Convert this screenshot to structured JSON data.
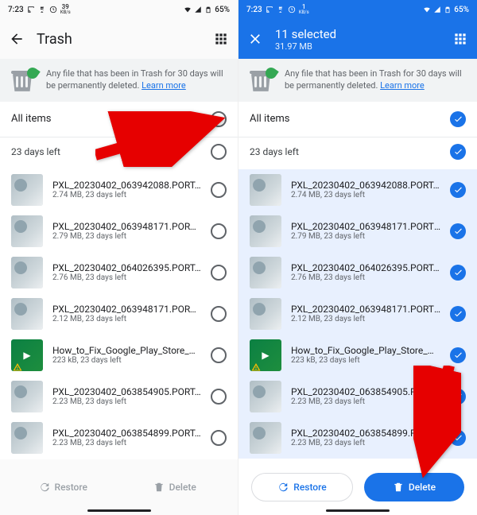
{
  "status": {
    "time": "7:23",
    "speed": "39",
    "speed_unit": "KB/s",
    "battery": "65%",
    "speed_r": "1"
  },
  "left": {
    "title": "Trash",
    "banner": "Any file that has been in Trash for 30 days will be permanently deleted. ",
    "learn": "Learn more",
    "section_all": "All items",
    "section_days": "23 days left",
    "restore": "Restore",
    "delete": "Delete"
  },
  "right": {
    "title": "11 selected",
    "subtitle": "31.97 MB",
    "banner": "Any file that has been in Trash for 30 days will be permanently deleted. ",
    "learn": "Learn more",
    "section_all": "All items",
    "section_days": "23 days left",
    "restore": "Restore",
    "delete": "Delete"
  },
  "files": [
    {
      "name": "PXL_20230402_063942088.PORT…",
      "sub": "2.74 MB, 23 days left",
      "kind": "photo"
    },
    {
      "name": "PXL_20230402_063948171.PORTR…",
      "sub": "2.79 MB, 23 days left",
      "kind": "photo"
    },
    {
      "name": "PXL_20230402_064026395.PORT…",
      "sub": "2.76 MB, 23 days left",
      "kind": "photo"
    },
    {
      "name": "PXL_20230402_063948171.PORTR…",
      "sub": "2.12 MB, 23 days left",
      "kind": "photo"
    },
    {
      "name": "How_to_Fix_Google_Play_Store_H…",
      "sub": "223 kB, 23 days left",
      "kind": "play"
    },
    {
      "name": "PXL_20230402_063854905.PORT…",
      "sub": "2.23 MB, 23 days left",
      "kind": "photo"
    },
    {
      "name": "PXL_20230402_063854899.PORT…",
      "sub": "2.23 MB, 23 days left",
      "kind": "photo"
    }
  ],
  "files_r": [
    {
      "name": "PXL_20230402_063942088.PORT…",
      "sub": "2.74 MB, 23 days left",
      "kind": "photo"
    },
    {
      "name": "PXL_20230402_063948171.PORTR…",
      "sub": "2.79 MB, 23 days left",
      "kind": "photo"
    },
    {
      "name": "PXL_20230402_064026395.PORT…",
      "sub": "2.76 MB, 23 days left",
      "kind": "photo"
    },
    {
      "name": "PXL_20230402_063948171.PORTR…",
      "sub": "2.12 MB, 23 days left",
      "kind": "photo"
    },
    {
      "name": "How_to_Fix_Google_Play_Store_H…",
      "sub": "223 kB, 23 days left",
      "kind": "play"
    },
    {
      "name": "PXL_20230402_063854905.PO…",
      "sub": "2.23 MB, 23 days left",
      "kind": "photo"
    },
    {
      "name": "PXL_20230402_063854899.PORT…",
      "sub": "2.23 MB, 23 days left",
      "kind": "photo"
    }
  ]
}
